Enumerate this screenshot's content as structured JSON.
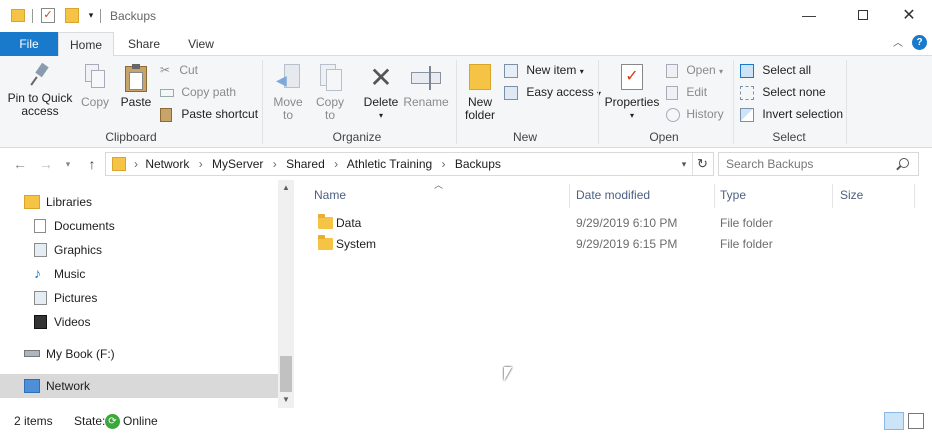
{
  "window": {
    "title": "Backups"
  },
  "ribbon_tabs": [
    "File",
    "Home",
    "Share",
    "View"
  ],
  "clipboard": {
    "group": "Clipboard",
    "pin_l1": "Pin to Quick",
    "pin_l2": "access",
    "copy": "Copy",
    "paste": "Paste",
    "cut": "Cut",
    "copy_path": "Copy path",
    "paste_shortcut": "Paste shortcut"
  },
  "organize": {
    "group": "Organize",
    "move_l1": "Move",
    "move_l2": "to",
    "copy_l1": "Copy",
    "copy_l2": "to",
    "delete": "Delete",
    "rename": "Rename"
  },
  "new": {
    "group": "New",
    "folder_l1": "New",
    "folder_l2": "folder",
    "new_item": "New item",
    "easy_access": "Easy access"
  },
  "open": {
    "group": "Open",
    "properties": "Properties",
    "open": "Open",
    "edit": "Edit",
    "history": "History"
  },
  "select": {
    "group": "Select",
    "select_all": "Select all",
    "select_none": "Select none",
    "invert": "Invert selection"
  },
  "address": {
    "crumbs": [
      "Network",
      "MyServer",
      "Shared",
      "Athletic Training",
      "Backups"
    ],
    "search_placeholder": "Search Backups"
  },
  "nav": {
    "items": [
      {
        "label": "Libraries",
        "icon": "libraries-icon"
      },
      {
        "label": "Documents",
        "icon": "documents-icon"
      },
      {
        "label": "Graphics",
        "icon": "pictures-icon"
      },
      {
        "label": "Music",
        "icon": "music-icon"
      },
      {
        "label": "Pictures",
        "icon": "pictures-icon"
      },
      {
        "label": "Videos",
        "icon": "videos-icon"
      },
      {
        "label": "My Book (F:)",
        "icon": "drive-icon"
      },
      {
        "label": "Network",
        "icon": "network-icon"
      }
    ]
  },
  "columns": {
    "name": "Name",
    "date": "Date modified",
    "type": "Type",
    "size": "Size"
  },
  "files": [
    {
      "name": "Data",
      "date": "9/29/2019 6:10 PM",
      "type": "File folder",
      "size": ""
    },
    {
      "name": "System",
      "date": "9/29/2019 6:15 PM",
      "type": "File folder",
      "size": ""
    }
  ],
  "status": {
    "items": "2 items",
    "state_label": "State:",
    "state": "Online"
  },
  "colors": {
    "file_tab": "#1979ca",
    "accent": "#0078d7",
    "folder": "#f6c445",
    "selected_nav": "#d9d9d9"
  }
}
